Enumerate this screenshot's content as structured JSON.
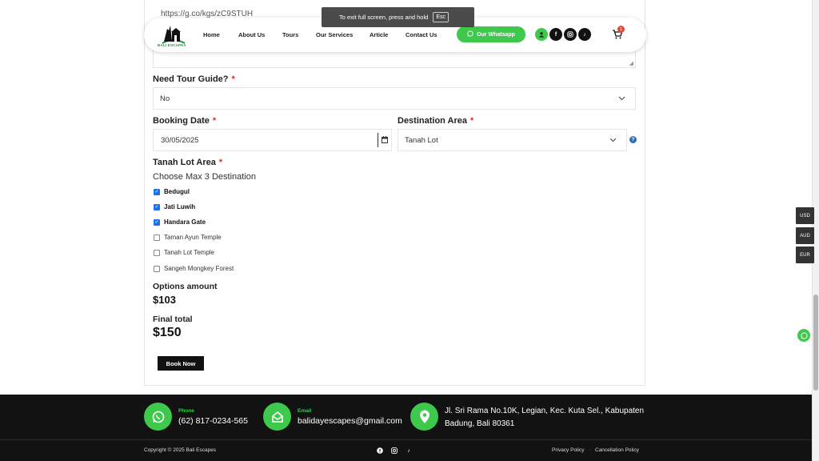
{
  "form": {
    "url_text": "https://g.co/kgs/zC9STUH",
    "guide": {
      "label": "Need Tour Guide?",
      "value": "No"
    },
    "booking_date": {
      "label": "Booking Date",
      "value": "30/05/2025"
    },
    "destination_area": {
      "label": "Destination Area",
      "value": "Tanah Lot"
    },
    "area": {
      "label": "Tanah Lot Area",
      "hint": "Choose Max 3 Destination",
      "options": [
        {
          "label": "Bedugul",
          "checked": true
        },
        {
          "label": "Jati Luwih",
          "checked": true
        },
        {
          "label": "Handara Gate",
          "checked": true
        },
        {
          "label": "Taman Ayun Temple",
          "checked": false
        },
        {
          "label": "Tanah Lot Temple",
          "checked": false
        },
        {
          "label": "Sangeh Mongkey Forest",
          "checked": false
        }
      ]
    },
    "required_mark": "*",
    "options_amount": {
      "label": "Options amount",
      "value": "$103"
    },
    "final_total": {
      "label": "Final total",
      "value": "$150"
    },
    "book_label": "Book Now"
  },
  "header": {
    "logo_text": "BALI ESCAPES",
    "nav": [
      "Home",
      "About Us",
      "Tours",
      "Our Services",
      "Article",
      "Contact Us"
    ],
    "whatsapp_label": "Our Whatsapp",
    "cart_count": "1"
  },
  "toast": {
    "text": "To exit full screen, press and hold",
    "key": "Esc"
  },
  "currency": [
    "USD",
    "AUD",
    "EUR"
  ],
  "footer": {
    "phone_label": "Phone",
    "phone_value": "(62) 817-0234-565",
    "email_label": "Email",
    "email_value": "balidayescapes@gmail.com",
    "address": "Jl. Sri Rama No.10K, Legian, Kec. Kuta Sel., Kabupaten Badung, Bali 80361",
    "copyright": "Copyright © 2025 Bali Escapes",
    "privacy": "Privacy Policy",
    "cancellation": "Cancellation Policy",
    "separator": "·"
  },
  "colors": {
    "accent": "#3ec94d",
    "checkbox": "#1a73e8",
    "required": "#e02b2b",
    "footer_bg": "#121212"
  }
}
